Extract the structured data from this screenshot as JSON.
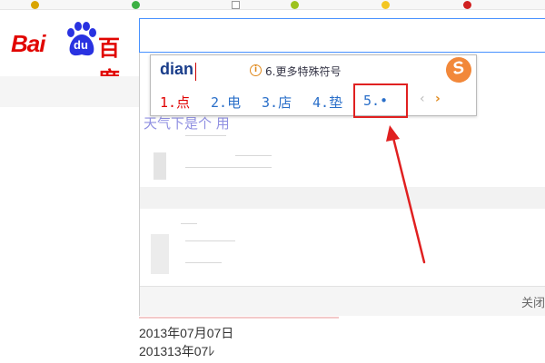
{
  "logo": {
    "latin": "Bai",
    "du": "du",
    "chinese": "百度"
  },
  "ime": {
    "composition": "dian",
    "more_symbols": "6.更多特殊符号",
    "info_glyph": "i",
    "brand_glyph": "S",
    "candidates": [
      {
        "num": "1.",
        "text": "点"
      },
      {
        "num": "2.",
        "text": "电"
      },
      {
        "num": "3.",
        "text": "店"
      },
      {
        "num": "4.",
        "text": "垫"
      },
      {
        "num": "5.",
        "text": "•"
      }
    ],
    "prev_glyph": "‹",
    "next_glyph": "›"
  },
  "dropdown": {
    "faded_text": "天气下是个 用",
    "close_label": "关闭"
  },
  "results": {
    "date_1": "2013年07月07日",
    "date_2": "201313年07ﾚ"
  },
  "colors": {
    "brand_red": "#e10602",
    "brand_blue": "#2932e1",
    "ime_accent": "#f2883a",
    "annotation": "#e02020"
  }
}
